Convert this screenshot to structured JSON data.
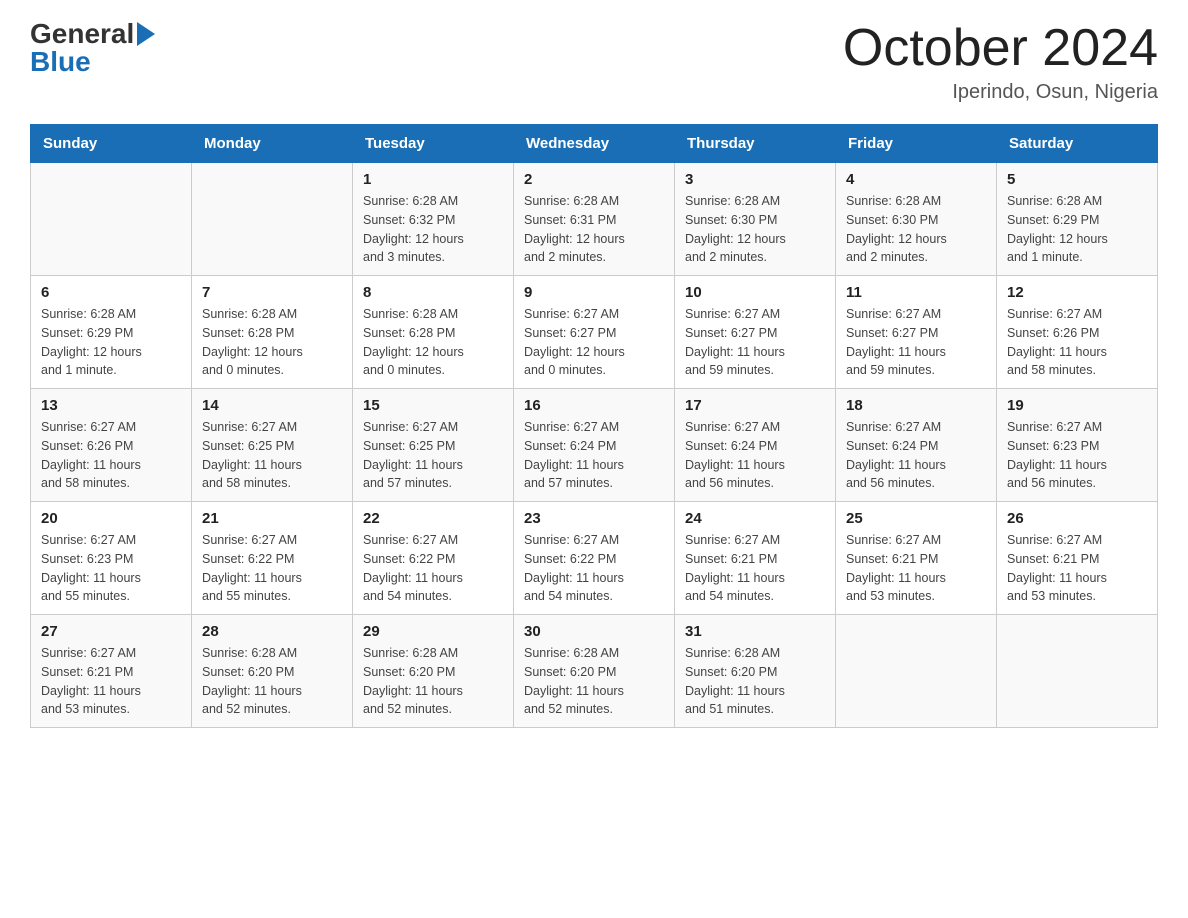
{
  "header": {
    "title": "October 2024",
    "subtitle": "Iperindo, Osun, Nigeria"
  },
  "logo": {
    "line1": "General",
    "line2": "Blue"
  },
  "days_of_week": [
    "Sunday",
    "Monday",
    "Tuesday",
    "Wednesday",
    "Thursday",
    "Friday",
    "Saturday"
  ],
  "weeks": [
    [
      {
        "day": "",
        "info": ""
      },
      {
        "day": "",
        "info": ""
      },
      {
        "day": "1",
        "info": "Sunrise: 6:28 AM\nSunset: 6:32 PM\nDaylight: 12 hours\nand 3 minutes."
      },
      {
        "day": "2",
        "info": "Sunrise: 6:28 AM\nSunset: 6:31 PM\nDaylight: 12 hours\nand 2 minutes."
      },
      {
        "day": "3",
        "info": "Sunrise: 6:28 AM\nSunset: 6:30 PM\nDaylight: 12 hours\nand 2 minutes."
      },
      {
        "day": "4",
        "info": "Sunrise: 6:28 AM\nSunset: 6:30 PM\nDaylight: 12 hours\nand 2 minutes."
      },
      {
        "day": "5",
        "info": "Sunrise: 6:28 AM\nSunset: 6:29 PM\nDaylight: 12 hours\nand 1 minute."
      }
    ],
    [
      {
        "day": "6",
        "info": "Sunrise: 6:28 AM\nSunset: 6:29 PM\nDaylight: 12 hours\nand 1 minute."
      },
      {
        "day": "7",
        "info": "Sunrise: 6:28 AM\nSunset: 6:28 PM\nDaylight: 12 hours\nand 0 minutes."
      },
      {
        "day": "8",
        "info": "Sunrise: 6:28 AM\nSunset: 6:28 PM\nDaylight: 12 hours\nand 0 minutes."
      },
      {
        "day": "9",
        "info": "Sunrise: 6:27 AM\nSunset: 6:27 PM\nDaylight: 12 hours\nand 0 minutes."
      },
      {
        "day": "10",
        "info": "Sunrise: 6:27 AM\nSunset: 6:27 PM\nDaylight: 11 hours\nand 59 minutes."
      },
      {
        "day": "11",
        "info": "Sunrise: 6:27 AM\nSunset: 6:27 PM\nDaylight: 11 hours\nand 59 minutes."
      },
      {
        "day": "12",
        "info": "Sunrise: 6:27 AM\nSunset: 6:26 PM\nDaylight: 11 hours\nand 58 minutes."
      }
    ],
    [
      {
        "day": "13",
        "info": "Sunrise: 6:27 AM\nSunset: 6:26 PM\nDaylight: 11 hours\nand 58 minutes."
      },
      {
        "day": "14",
        "info": "Sunrise: 6:27 AM\nSunset: 6:25 PM\nDaylight: 11 hours\nand 58 minutes."
      },
      {
        "day": "15",
        "info": "Sunrise: 6:27 AM\nSunset: 6:25 PM\nDaylight: 11 hours\nand 57 minutes."
      },
      {
        "day": "16",
        "info": "Sunrise: 6:27 AM\nSunset: 6:24 PM\nDaylight: 11 hours\nand 57 minutes."
      },
      {
        "day": "17",
        "info": "Sunrise: 6:27 AM\nSunset: 6:24 PM\nDaylight: 11 hours\nand 56 minutes."
      },
      {
        "day": "18",
        "info": "Sunrise: 6:27 AM\nSunset: 6:24 PM\nDaylight: 11 hours\nand 56 minutes."
      },
      {
        "day": "19",
        "info": "Sunrise: 6:27 AM\nSunset: 6:23 PM\nDaylight: 11 hours\nand 56 minutes."
      }
    ],
    [
      {
        "day": "20",
        "info": "Sunrise: 6:27 AM\nSunset: 6:23 PM\nDaylight: 11 hours\nand 55 minutes."
      },
      {
        "day": "21",
        "info": "Sunrise: 6:27 AM\nSunset: 6:22 PM\nDaylight: 11 hours\nand 55 minutes."
      },
      {
        "day": "22",
        "info": "Sunrise: 6:27 AM\nSunset: 6:22 PM\nDaylight: 11 hours\nand 54 minutes."
      },
      {
        "day": "23",
        "info": "Sunrise: 6:27 AM\nSunset: 6:22 PM\nDaylight: 11 hours\nand 54 minutes."
      },
      {
        "day": "24",
        "info": "Sunrise: 6:27 AM\nSunset: 6:21 PM\nDaylight: 11 hours\nand 54 minutes."
      },
      {
        "day": "25",
        "info": "Sunrise: 6:27 AM\nSunset: 6:21 PM\nDaylight: 11 hours\nand 53 minutes."
      },
      {
        "day": "26",
        "info": "Sunrise: 6:27 AM\nSunset: 6:21 PM\nDaylight: 11 hours\nand 53 minutes."
      }
    ],
    [
      {
        "day": "27",
        "info": "Sunrise: 6:27 AM\nSunset: 6:21 PM\nDaylight: 11 hours\nand 53 minutes."
      },
      {
        "day": "28",
        "info": "Sunrise: 6:28 AM\nSunset: 6:20 PM\nDaylight: 11 hours\nand 52 minutes."
      },
      {
        "day": "29",
        "info": "Sunrise: 6:28 AM\nSunset: 6:20 PM\nDaylight: 11 hours\nand 52 minutes."
      },
      {
        "day": "30",
        "info": "Sunrise: 6:28 AM\nSunset: 6:20 PM\nDaylight: 11 hours\nand 52 minutes."
      },
      {
        "day": "31",
        "info": "Sunrise: 6:28 AM\nSunset: 6:20 PM\nDaylight: 11 hours\nand 51 minutes."
      },
      {
        "day": "",
        "info": ""
      },
      {
        "day": "",
        "info": ""
      }
    ]
  ]
}
